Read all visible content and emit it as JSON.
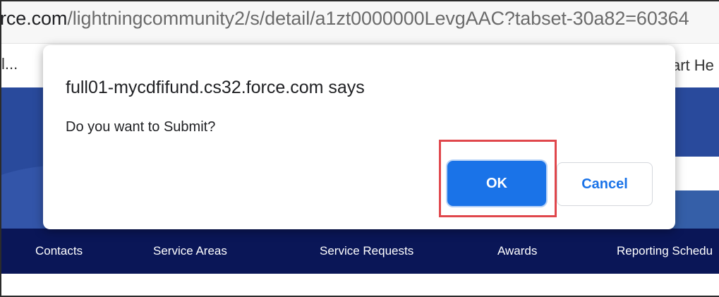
{
  "browser": {
    "url_host": "rce.com",
    "url_path": "/lightningcommunity2/s/detail/a1zt0000000LevgAAC?tabset-30a82=60364"
  },
  "bookmarks": {
    "left_label": "l...",
    "right_label": "art He"
  },
  "nav": {
    "items": [
      "Contacts",
      "Service Areas",
      "Service Requests",
      "Awards",
      "Reporting Schedu"
    ]
  },
  "dialog": {
    "title": "full01-mycdfifund.cs32.force.com says",
    "message": "Do you want to Submit?",
    "ok_label": "OK",
    "cancel_label": "Cancel"
  },
  "colors": {
    "accent": "#1a73e8",
    "nav_bg": "#0a1657",
    "hero_bg": "#294a9c",
    "highlight": "#e0474c"
  }
}
